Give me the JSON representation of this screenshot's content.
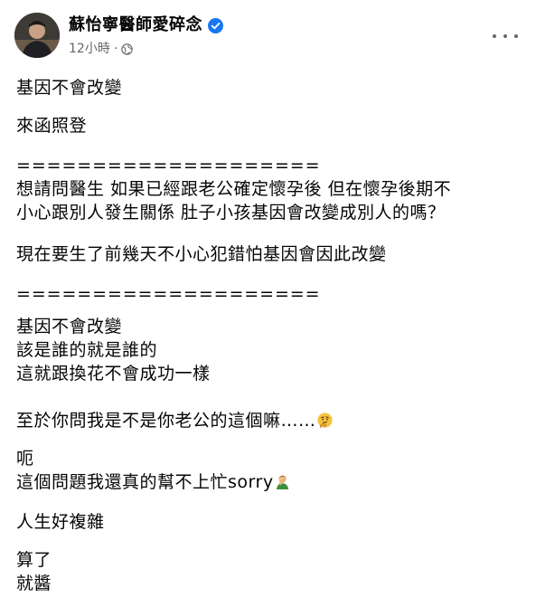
{
  "post": {
    "author": "蘇怡寧醫師愛碎念",
    "time": "12小時",
    "separator": "·",
    "icons": {
      "verified": "verified-badge-icon",
      "audience": "globe-icon",
      "more": "more-options-icon",
      "emoji_thinking": "thinking-face-emoji",
      "emoji_facepalm": "person-facepalming-emoji"
    },
    "colors": {
      "verified": "#1877f2",
      "meta": "#65676b",
      "text": "#050505"
    },
    "paragraphs": [
      {
        "lines": [
          "基因不會改變"
        ]
      },
      {
        "lines": [
          "來函照登"
        ]
      },
      {
        "lines": [
          "====================",
          "想請問醫生 如果已經跟老公確定懷孕後 但在懷孕後期不",
          "小心跟別人發生關係 肚子小孩基因會改變成別人的嗎？"
        ]
      },
      {
        "lines": [
          "現在要生了前幾天不小心犯錯怕基因會因此改變"
        ]
      },
      {
        "lines": [
          "===================="
        ]
      },
      {
        "lines": [
          "基因不會改變",
          "該是誰的就是誰的",
          "這就跟換花不會成功一樣"
        ]
      },
      {
        "lines": [
          "至於你問我是不是你老公的這個嘛……"
        ]
      },
      {
        "lines": [
          "呃",
          "這個問題我還真的幫不上忙sorry"
        ]
      },
      {
        "lines": [
          "人生好複雜"
        ]
      },
      {
        "lines": [
          "算了",
          "就醬"
        ]
      }
    ]
  }
}
